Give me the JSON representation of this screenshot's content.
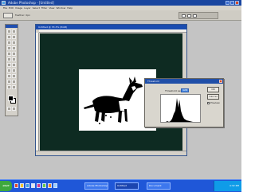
{
  "app": {
    "title": "Adobe Photoshop - [Untitled]"
  },
  "menu": [
    "File",
    "Edit",
    "Image",
    "Layer",
    "Select",
    "Filter",
    "View",
    "Window",
    "Help"
  ],
  "options": {
    "label": "Feather: 0px"
  },
  "document": {
    "title": "Untitled @ 33.3% (RGB)",
    "canvas_color": "#0e2b22"
  },
  "dialog": {
    "title": "Threshold",
    "label": "Threshold Level:",
    "value": "128",
    "buttons": [
      "OK",
      "Cancel"
    ],
    "preview_label": "Preview"
  },
  "taskbar": {
    "start_label": "start",
    "tasks": [
      "Adobe Photoshop",
      "Untitled",
      "Document"
    ],
    "clock": "4:32 PM"
  }
}
